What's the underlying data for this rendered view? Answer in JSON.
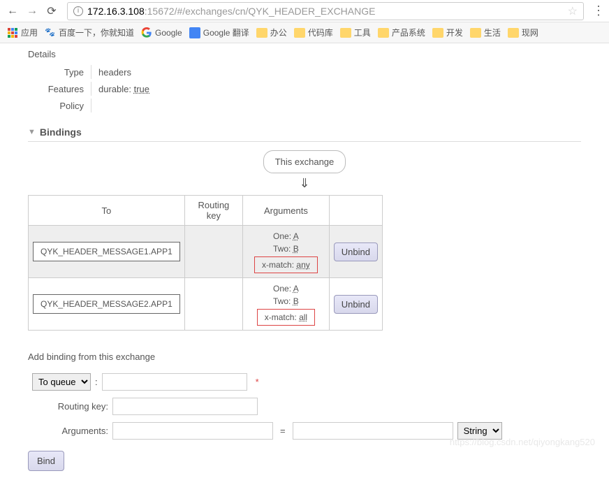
{
  "browser": {
    "url_host": "172.16.3.108",
    "url_rest": ":15672/#/exchanges/cn/QYK_HEADER_EXCHANGE"
  },
  "bookmarks": {
    "apps": "应用",
    "baidu": "百度一下，你就知道",
    "google": "Google",
    "google_translate": "Google 翻译",
    "items": [
      "办公",
      "代码库",
      "工具",
      "产品系统",
      "开发",
      "生活",
      "现网"
    ]
  },
  "details": {
    "heading": "Details",
    "type_label": "Type",
    "type_value": "headers",
    "features_label": "Features",
    "features_key": "durable:",
    "features_value": "true",
    "policy_label": "Policy"
  },
  "bindings": {
    "heading": "Bindings",
    "this_exchange": "This exchange",
    "headers": {
      "to": "To",
      "routing_key": "Routing key",
      "arguments": "Arguments"
    },
    "rows": [
      {
        "to": "QYK_HEADER_MESSAGE1.APP1",
        "args": {
          "One": "A",
          "Two": "B",
          "xmatch_key": "x-match:",
          "xmatch_val": "any"
        }
      },
      {
        "to": "QYK_HEADER_MESSAGE2.APP1",
        "args": {
          "One": "A",
          "Two": "B",
          "xmatch_key": "x-match:",
          "xmatch_val": "all"
        }
      }
    ],
    "unbind_label": "Unbind"
  },
  "form": {
    "heading": "Add binding from this exchange",
    "destination_type": "To queue",
    "routing_key_label": "Routing key:",
    "arguments_label": "Arguments:",
    "arg_type": "String",
    "bind_label": "Bind",
    "asterisk": "*"
  },
  "watermark": "https://blog.csdn.net/qiyongkang520"
}
